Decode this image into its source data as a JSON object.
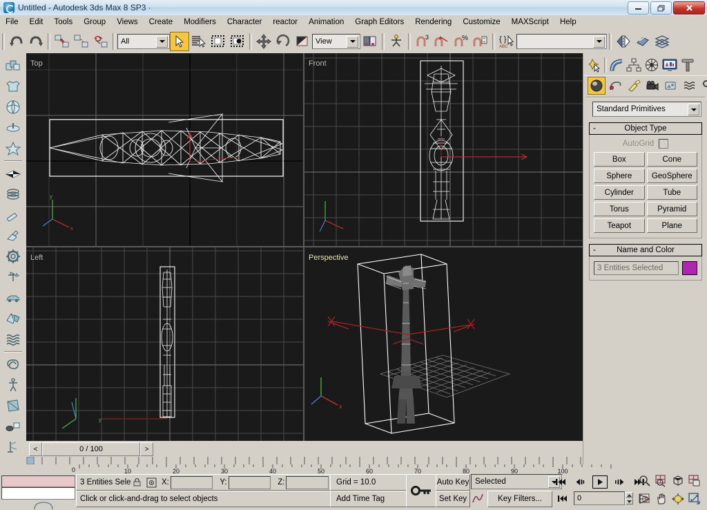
{
  "window": {
    "title": "Untitled - Autodesk 3ds Max 8 SP3  ·",
    "minimize_label": "—",
    "maximize_label": "❐",
    "close_label": "✕",
    "logo_icon": "max-logo-icon"
  },
  "menubar": {
    "items": [
      {
        "label": "File"
      },
      {
        "label": "Edit"
      },
      {
        "label": "Tools"
      },
      {
        "label": "Group"
      },
      {
        "label": "Views"
      },
      {
        "label": "Create"
      },
      {
        "label": "Modifiers"
      },
      {
        "label": "Character"
      },
      {
        "label": "reactor"
      },
      {
        "label": "Animation"
      },
      {
        "label": "Graph Editors"
      },
      {
        "label": "Rendering"
      },
      {
        "label": "Customize"
      },
      {
        "label": "MAXScript"
      },
      {
        "label": "Help"
      }
    ]
  },
  "toolbar": {
    "undo_icon": "undo-icon",
    "redo_icon": "redo-icon",
    "select_link_icon": "select-and-link-icon",
    "unlink_icon": "unlink-selection-icon",
    "bind_space_warp_icon": "bind-to-space-warp-icon",
    "selection_filter_value": "All",
    "select_object_icon": "select-object-icon",
    "select_by_name_icon": "select-by-name-icon",
    "rectangular_select_icon": "rectangular-selection-region-icon",
    "window_crossing_icon": "window-crossing-icon",
    "select_move_icon": "select-and-move-icon",
    "select_rotate_icon": "select-and-rotate-icon",
    "select_scale_icon": "select-and-uniform-scale-icon",
    "reference_coord_value": "View",
    "use_center_icon": "use-pivot-point-center-icon",
    "select_manipulate_icon": "select-and-manipulate-icon",
    "snap_toggle_icon": "snaps-toggle-3-icon",
    "angle_snap_icon": "angle-snap-toggle-icon",
    "percent_snap_icon": "percent-snap-toggle-icon",
    "spinner_snap_icon": "spinner-snap-toggle-icon",
    "named_selection_icon": "named-selection-sets-icon",
    "named_selection_value": "",
    "mirror_icon": "mirror-icon",
    "align_icon": "align-icon",
    "layer_manager_icon": "layer-manager-icon"
  },
  "left_toolbar": {
    "items": [
      {
        "icon": "boxes-icon",
        "name": "boxes"
      },
      {
        "icon": "shirt-icon",
        "name": "cloth"
      },
      {
        "icon": "ball-icon",
        "name": "rigid-body"
      },
      {
        "icon": "spinning-top-icon",
        "name": "soft-body"
      },
      {
        "icon": "star-object-icon",
        "name": "deforming-mesh"
      },
      {
        "icon": "plane-collection-icon",
        "name": "plane"
      },
      {
        "icon": "springs-icon",
        "name": "spring"
      },
      {
        "icon": "dashpot-icon",
        "name": "dashpot"
      },
      {
        "icon": "motor-icon",
        "name": "motor"
      },
      {
        "icon": "gear-icon",
        "name": "toy-car"
      },
      {
        "icon": "windmill-icon",
        "name": "wind"
      },
      {
        "icon": "car-icon",
        "name": "vehicle"
      },
      {
        "icon": "fracture-icon",
        "name": "fracture"
      },
      {
        "icon": "water-icon",
        "name": "water"
      },
      {
        "icon": "rope-icon",
        "name": "rope"
      },
      {
        "icon": "ragdoll-icon",
        "name": "ragdoll"
      },
      {
        "icon": "cloth-patch-icon",
        "name": "cloth-modifier"
      },
      {
        "icon": "collision-icon",
        "name": "collision"
      },
      {
        "icon": "preview-animation-icon",
        "name": "preview-animation"
      }
    ]
  },
  "viewports": [
    {
      "label": "Top",
      "active": false,
      "name": "viewport-top"
    },
    {
      "label": "Front",
      "active": false,
      "name": "viewport-front"
    },
    {
      "label": "Left",
      "active": false,
      "name": "viewport-left"
    },
    {
      "label": "Perspective",
      "active": true,
      "name": "viewport-perspective"
    }
  ],
  "trackbar": {
    "prev_frame_label": "<",
    "next_frame_label": ">",
    "current_frame_display": "0 / 100",
    "ruler_ticks": [
      "0",
      "10",
      "20",
      "30",
      "40",
      "50",
      "60",
      "70",
      "80",
      "90",
      "100"
    ]
  },
  "command_panel": {
    "tabs": [
      {
        "icon": "create-tab-icon",
        "name": "create",
        "active": true
      },
      {
        "icon": "modify-tab-icon",
        "name": "modify",
        "active": false
      },
      {
        "icon": "hierarchy-tab-icon",
        "name": "hierarchy",
        "active": false
      },
      {
        "icon": "motion-tab-icon",
        "name": "motion",
        "active": false
      },
      {
        "icon": "display-tab-icon",
        "name": "display",
        "active": false
      },
      {
        "icon": "utilities-tab-icon",
        "name": "utilities",
        "active": false
      }
    ],
    "sub_tabs": [
      {
        "icon": "geometry-icon",
        "name": "geometry",
        "active": true
      },
      {
        "icon": "shapes-icon",
        "name": "shapes",
        "active": false
      },
      {
        "icon": "lights-icon",
        "name": "lights",
        "active": false
      },
      {
        "icon": "cameras-icon",
        "name": "cameras",
        "active": false
      },
      {
        "icon": "helpers-icon",
        "name": "helpers",
        "active": false
      },
      {
        "icon": "space-warps-icon",
        "name": "space-warps",
        "active": false
      },
      {
        "icon": "systems-icon",
        "name": "systems",
        "active": false
      }
    ],
    "category_value": "Standard Primitives",
    "object_type": {
      "header": "Object Type",
      "collapse_glyph": "-",
      "autogrid_label": "AutoGrid",
      "autogrid_checked": false,
      "buttons": [
        "Box",
        "Cone",
        "Sphere",
        "GeoSphere",
        "Cylinder",
        "Tube",
        "Torus",
        "Pyramid",
        "Teapot",
        "Plane"
      ]
    },
    "name_and_color": {
      "header": "Name and Color",
      "collapse_glyph": "-",
      "name_value": "3 Entities Selected",
      "color_hex": "#b026b0"
    }
  },
  "status_bar": {
    "selection_text": "3 Entities Sele",
    "lock_icon": "selection-lock-icon",
    "coord_mode_icon": "absolute-relative-coords-icon",
    "x_label": "X:",
    "x_value": "",
    "y_label": "Y:",
    "y_value": "",
    "z_label": "Z:",
    "z_value": "",
    "grid_text": "Grid = 10.0",
    "prompt_text": "Click or click-and-drag to select objects",
    "add_time_tag": "Add Time Tag",
    "key_mode_icon": "key-mode-toggle-icon",
    "auto_key_label": "Auto Key",
    "set_key_label": "Set Key",
    "key_filters_label": "Key Filters...",
    "selection_level_value": "Selected",
    "curve_icon": "set-key-curve-icon",
    "mini_listener_top_color": "#e8c8c8",
    "mini_listener_bottom_color": "#ffffff"
  },
  "playback": {
    "go_to_start_icon": "go-to-start-icon",
    "prev_frame_icon": "previous-frame-icon",
    "play_icon": "play-animation-icon",
    "next_frame_icon": "next-frame-icon",
    "go_to_end_icon": "go-to-end-icon",
    "key_mode_icon": "key-mode-toggle-icon",
    "frame_value": "0",
    "time_config_icon": "time-configuration-icon",
    "spinner_up": "▲",
    "spinner_down": "▼"
  },
  "nav_controls": {
    "items": [
      {
        "icon": "zoom-icon",
        "name": "zoom"
      },
      {
        "icon": "zoom-all-icon",
        "name": "zoom-all"
      },
      {
        "icon": "zoom-extents-icon",
        "name": "zoom-extents"
      },
      {
        "icon": "zoom-extents-all-icon",
        "name": "zoom-extents-all"
      },
      {
        "icon": "field-of-view-icon",
        "name": "field-of-view"
      },
      {
        "icon": "pan-icon",
        "name": "pan"
      },
      {
        "icon": "arc-rotate-icon",
        "name": "arc-rotate"
      },
      {
        "icon": "maximize-viewport-icon",
        "name": "maximize-viewport-toggle"
      }
    ]
  }
}
